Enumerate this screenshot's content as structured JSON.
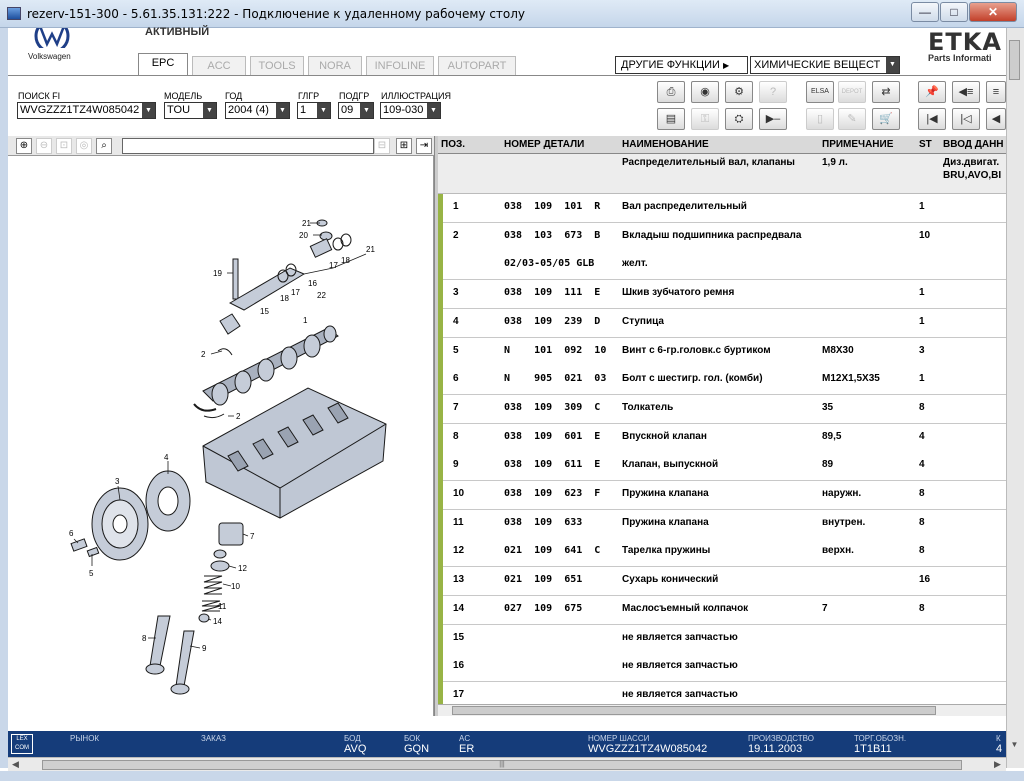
{
  "window": {
    "title": "rezerv-151-300 - 5.61.35.131:222 - Подключение к удаленному рабочему столу",
    "minimize": "—",
    "maximize": "□",
    "close": "✕"
  },
  "brand": {
    "name": "Volkswagen",
    "status": "АКТИВНЫЙ",
    "app_logo": "ETKA",
    "app_sub": "Parts Informati"
  },
  "tabs": [
    {
      "label": "EPC",
      "active": true
    },
    {
      "label": "ACC",
      "active": false
    },
    {
      "label": "TOOLS",
      "active": false
    },
    {
      "label": "NORA",
      "active": false
    },
    {
      "label": "INFOLINE",
      "active": false
    },
    {
      "label": "AUTOPART",
      "active": false
    }
  ],
  "other_functions": {
    "label": "ДРУГИЕ ФУНКЦИИ",
    "selected": "ХИМИЧЕСКИЕ ВЕЩЕСТ"
  },
  "filters": {
    "fi_label": "ПОИСК FI",
    "fi_value": "WVGZZZ1TZ4W085042",
    "model_label": "МОДЕЛЬ",
    "model_value": "TOU",
    "year_label": "ГОД",
    "year_value": "2004 (4)",
    "hg_label": "ГЛГР",
    "hg_value": "1",
    "ug_label": "ПОДГР",
    "ug_value": "09",
    "ill_label": "ИЛЛЮСТРАЦИЯ",
    "ill_value": "109-030"
  },
  "toolbar_icons": [
    "print-icon",
    "cd-icon",
    "car-icon",
    "help-icon",
    "elsa-icon",
    "depot-icon",
    "cart-arrow-icon",
    "pin-icon",
    "list-back-icon",
    "list-icon",
    "table-icon",
    "key-icon",
    "engine-icon",
    "play-step-icon",
    "device-icon",
    "tool-icon",
    "cart-icon",
    "first-icon",
    "prev-icon",
    "back-icon"
  ],
  "table": {
    "headers": {
      "pos": "ПОЗ.",
      "number": "НОМЕР ДЕТАЛИ",
      "name": "НАИМЕНОВАНИЕ",
      "note": "ПРИМЕЧАНИЕ",
      "qty": "ST",
      "input": "ВВОД ДАНН"
    },
    "group": {
      "name": "Распределительный вал, клапаны",
      "note": "1,9 л.",
      "input_line1": "Диз.двигат.",
      "input_line2": "BRU,AVO,BI"
    },
    "rows": [
      {
        "pos": "1",
        "number": "038  109  101  R",
        "name": "Вал распределительный",
        "note": "",
        "qty": "1"
      },
      {
        "pos": "2",
        "number": "038  103  673  B",
        "name": "Вкладыш подшипника распредвала",
        "note": "",
        "qty": "10"
      },
      {
        "pos": "",
        "number": "02/03-05/05 GLB",
        "name": "желт.",
        "note": "",
        "qty": ""
      },
      {
        "pos": "3",
        "number": "038  109  111  E",
        "name": "Шкив зубчатого ремня",
        "note": "",
        "qty": "1"
      },
      {
        "pos": "4",
        "number": "038  109  239  D",
        "name": "Ступица",
        "note": "",
        "qty": "1"
      },
      {
        "pos": "5",
        "number": "N    101  092  10",
        "name": "Винт с 6-гр.головк.с буртиком",
        "note": "M8X30",
        "qty": "3"
      },
      {
        "pos": "6",
        "number": "N    905  021  03",
        "name": "Болт с шестигр. гол. (комби)",
        "note": "M12X1,5X35",
        "qty": "1"
      },
      {
        "pos": "7",
        "number": "038  109  309  C",
        "name": "Толкатель",
        "note": "35",
        "qty": "8"
      },
      {
        "pos": "8",
        "number": "038  109  601  E",
        "name": "Впускной клапан",
        "note": "89,5",
        "qty": "4"
      },
      {
        "pos": "9",
        "number": "038  109  611  E",
        "name": "Клапан, выпускной",
        "note": "89",
        "qty": "4"
      },
      {
        "pos": "10",
        "number": "038  109  623  F",
        "name": "Пружина клапана",
        "note": "наружн.",
        "qty": "8"
      },
      {
        "pos": "11",
        "number": "038  109  633",
        "name": "Пружина клапана",
        "note": "внутрен.",
        "qty": "8"
      },
      {
        "pos": "12",
        "number": "021  109  641  C",
        "name": "Тарелка пружины",
        "note": "верхн.",
        "qty": "8"
      },
      {
        "pos": "13",
        "number": "021  109  651",
        "name": "Сухарь конический",
        "note": "",
        "qty": "16"
      },
      {
        "pos": "14",
        "number": "027  109  675",
        "name": "Маслосъемный колпачок",
        "note": "7",
        "qty": "8"
      },
      {
        "pos": "15",
        "number": "",
        "name": "не является запчастью",
        "note": "",
        "qty": ""
      },
      {
        "pos": "16",
        "number": "",
        "name": "не является запчастью",
        "note": "",
        "qty": ""
      },
      {
        "pos": "17",
        "number": "",
        "name": "не является запчастью",
        "note": "",
        "qty": ""
      }
    ]
  },
  "diagram_labels": [
    "21",
    "20",
    "17",
    "18",
    "21",
    "19",
    "16",
    "17",
    "18",
    "15",
    "22",
    "2",
    "1",
    "2",
    "4",
    "3",
    "6",
    "5",
    "7",
    "12",
    "10",
    "11",
    "14",
    "8",
    "9"
  ],
  "status": {
    "logo": "LEX COM",
    "market_label": "РЫНОК",
    "order_label": "ЗАКАЗ",
    "engine_label": "БОД",
    "engine_value": "AVQ",
    "gearbox_label": "БОК",
    "gearbox_value": "GQN",
    "ac_label": "AC",
    "ac_value": "ER",
    "chassis_label": "НОМЕР ШАССИ",
    "chassis_value": "WVGZZZ1TZ4W085042",
    "prod_label": "ПРОИЗВОДСТВО",
    "prod_value": "19.11.2003",
    "trade_label": "ТОРГ.ОБОЗН.",
    "trade_value": "1T1B11",
    "extra_label": "К",
    "extra_value": "4"
  },
  "colors": {
    "row_marker": "#98b446",
    "status_bar": "#153c7a"
  }
}
